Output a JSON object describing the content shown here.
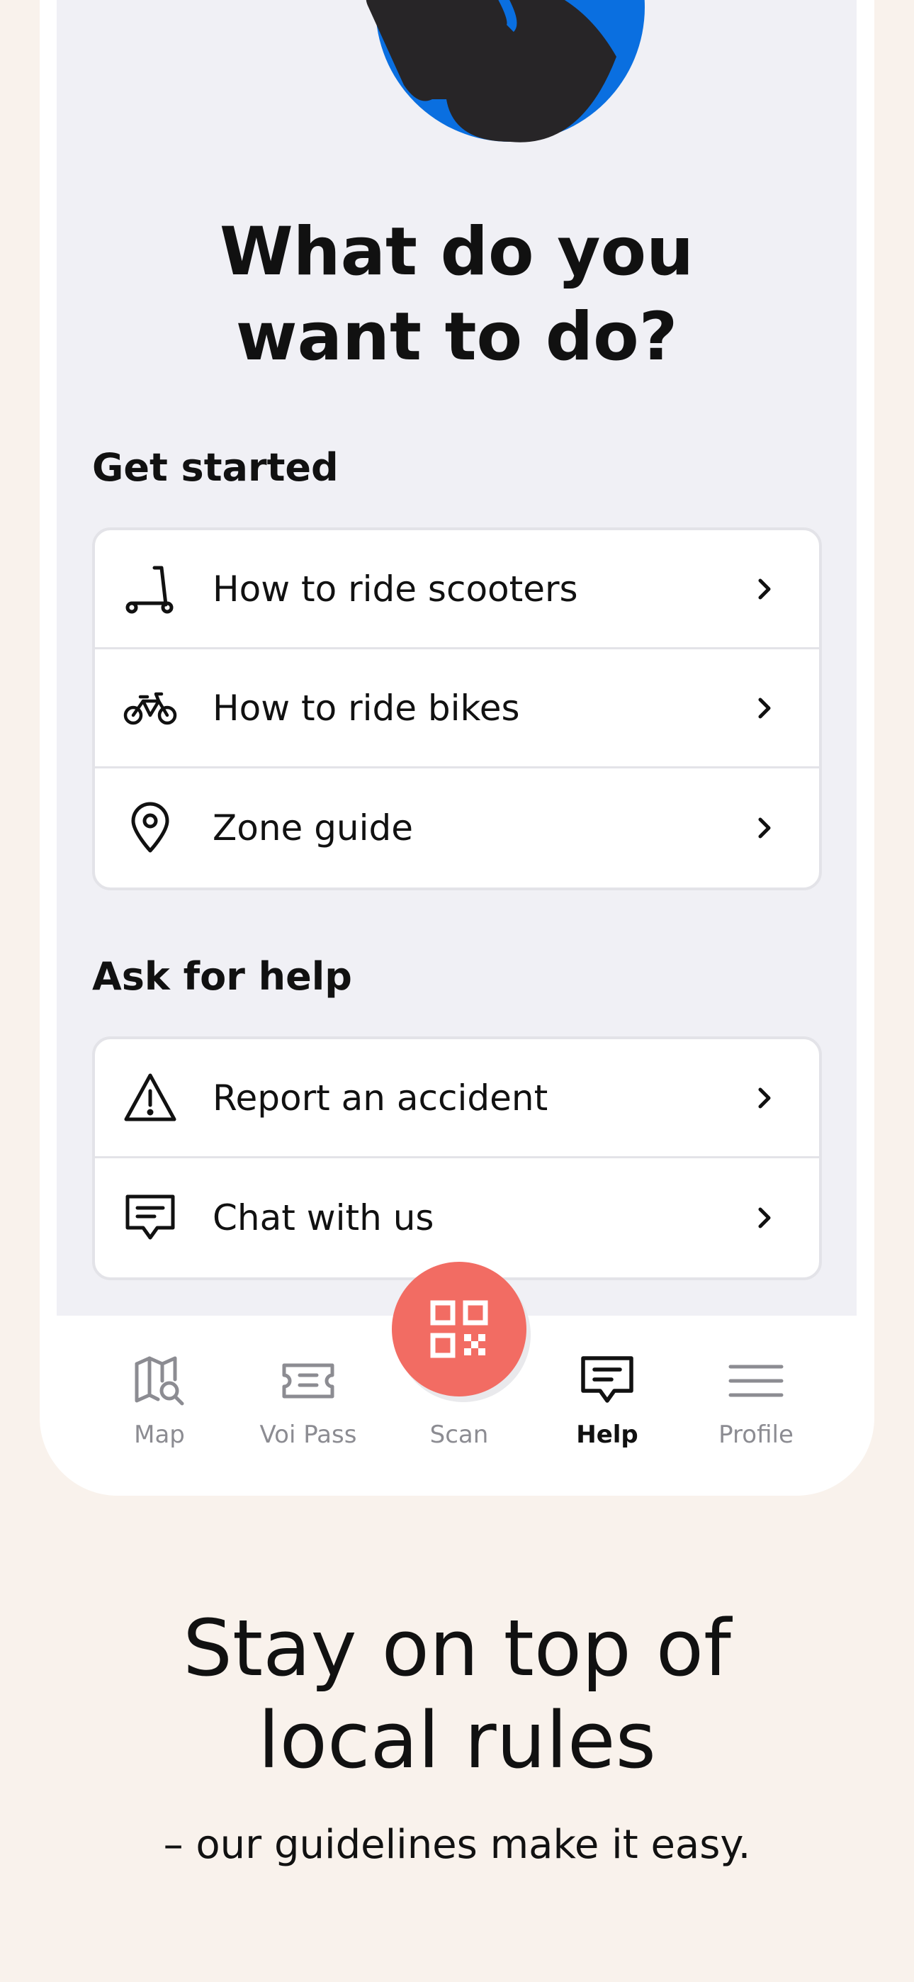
{
  "heading": "What do you want to do?",
  "sections": {
    "get_started": {
      "title": "Get started",
      "items": [
        {
          "label": "How to ride scooters",
          "icon": "scooter-icon"
        },
        {
          "label": "How to ride bikes",
          "icon": "bike-icon"
        },
        {
          "label": "Zone guide",
          "icon": "location-pin-icon"
        }
      ]
    },
    "ask_for_help": {
      "title": "Ask for help",
      "items": [
        {
          "label": "Report an accident",
          "icon": "warning-icon"
        },
        {
          "label": "Chat with us",
          "icon": "chat-icon"
        }
      ]
    }
  },
  "nav": {
    "map": "Map",
    "voi_pass": "Voi Pass",
    "scan": "Scan",
    "help": "Help",
    "profile": "Profile",
    "active": "Help"
  },
  "promo": {
    "title": "Stay on top of local rules",
    "subtitle": "– our guidelines make it easy."
  },
  "colors": {
    "background": "#f9f2ec",
    "screen_bg": "#f0f0f5",
    "scan_button": "#f26c63",
    "illustration_blue": "#0a6fe0",
    "illustration_dark": "#272527"
  }
}
